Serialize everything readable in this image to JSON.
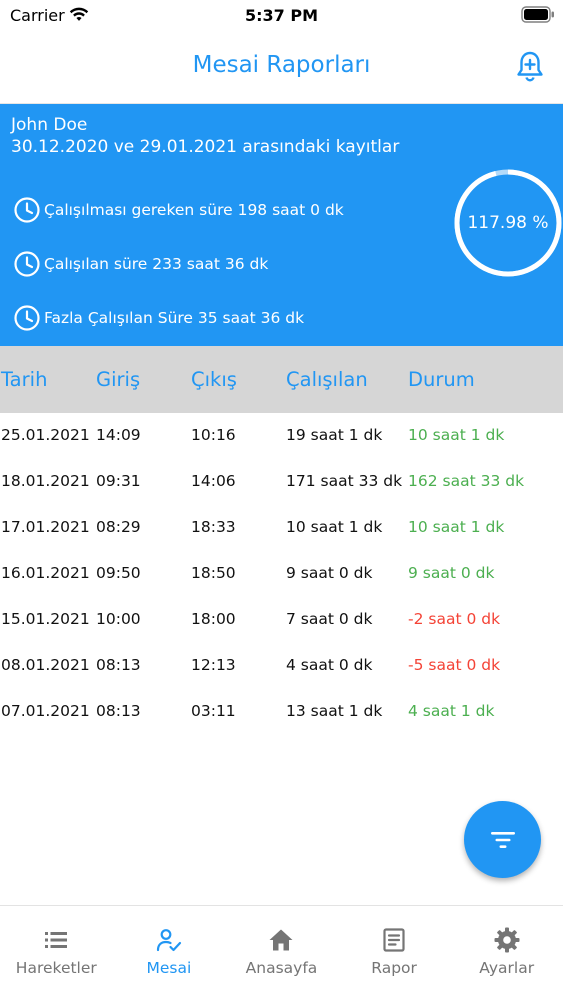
{
  "status": {
    "carrier": "Carrier",
    "time": "5:37 PM"
  },
  "header": {
    "title": "Mesai Raporları"
  },
  "summary": {
    "name": "John Doe",
    "range": "30.12.2020 ve 29.01.2021 arasındaki kayıtlar",
    "required": "Çalışılması gereken süre 198 saat 0 dk",
    "worked": "Çalışılan  süre 233 saat 36 dk",
    "overtime": "Fazla Çalışılan Süre 35 saat 36 dk",
    "percent_label": "117.98 %",
    "gauge_fraction": 0.96
  },
  "table": {
    "headers": [
      "Tarih",
      "Giriş",
      "Çıkış",
      "Çalışılan",
      "Durum"
    ],
    "rows": [
      [
        "25.01.2021",
        "14:09",
        "10:16",
        "19 saat 1 dk",
        "10 saat 1 dk",
        "positive"
      ],
      [
        "18.01.2021",
        "09:31",
        "14:06",
        "171 saat 33 dk",
        "162 saat 33 dk",
        "positive"
      ],
      [
        "17.01.2021",
        "08:29",
        "18:33",
        "10 saat 1 dk",
        "10 saat 1 dk",
        "positive"
      ],
      [
        "16.01.2021",
        "09:50",
        "18:50",
        "9 saat 0 dk",
        "9 saat 0 dk",
        "positive"
      ],
      [
        "15.01.2021",
        "10:00",
        "18:00",
        "7 saat 0 dk",
        "-2 saat 0 dk",
        "negative"
      ],
      [
        "08.01.2021",
        "08:13",
        "12:13",
        "4 saat 0 dk",
        "-5 saat 0 dk",
        "negative"
      ],
      [
        "07.01.2021",
        "08:13",
        "03:11",
        "13 saat 1 dk",
        "4 saat 1 dk",
        "positive"
      ]
    ]
  },
  "colors": {
    "accent": "#2196F3",
    "positive": "#4CAF50",
    "negative": "#F44336",
    "muted": "#757575"
  },
  "nav": {
    "items": [
      {
        "label": "Hareketler",
        "icon": "list-icon"
      },
      {
        "label": "Mesai",
        "icon": "user-check-icon"
      },
      {
        "label": "Anasayfa",
        "icon": "home-icon"
      },
      {
        "label": "Rapor",
        "icon": "document-icon"
      },
      {
        "label": "Ayarlar",
        "icon": "gear-icon"
      }
    ],
    "active_index": 1
  },
  "fab": {
    "icon": "filter-icon"
  }
}
